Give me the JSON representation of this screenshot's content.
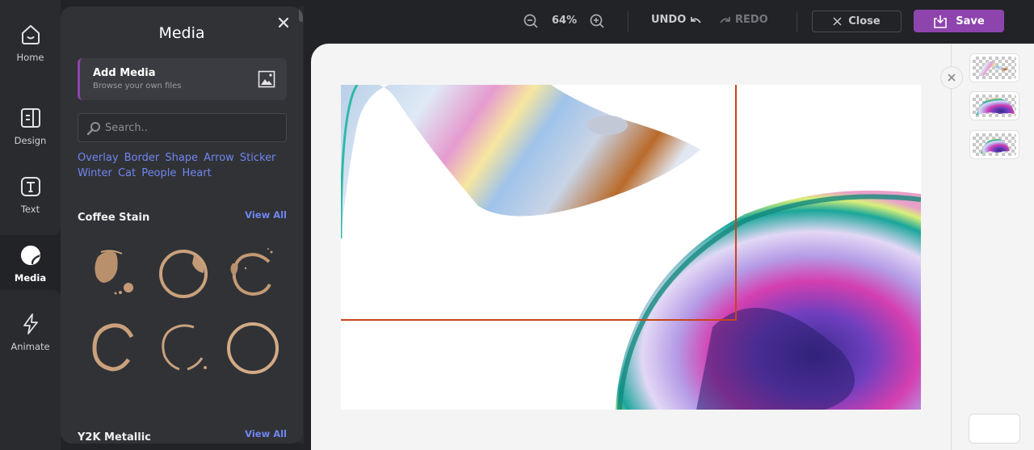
{
  "rail": {
    "items": [
      {
        "label": "Home",
        "icon": "home-icon"
      },
      {
        "label": "Design",
        "icon": "design-icon"
      },
      {
        "label": "Text",
        "icon": "text-icon"
      },
      {
        "label": "Media",
        "icon": "media-sticker-icon",
        "active": true
      },
      {
        "label": "Animate",
        "icon": "lightning-icon"
      }
    ]
  },
  "panel": {
    "title": "Media",
    "add_media": {
      "title": "Add Media",
      "subtitle": "Browse your own files"
    },
    "search": {
      "placeholder": "Search.."
    },
    "tags": [
      "Overlay",
      "Border",
      "Shape",
      "Arrow",
      "Sticker",
      "Winter",
      "Cat",
      "People",
      "Heart"
    ],
    "sections": [
      {
        "title": "Coffee Stain",
        "view_all": "View All",
        "item_count": 6
      },
      {
        "title": "Y2K Metallic",
        "view_all": "View All"
      }
    ]
  },
  "toolbar": {
    "zoom_value": "64%",
    "undo_label": "UNDO",
    "redo_label": "REDO",
    "close_label": "Close",
    "save_label": "Save"
  },
  "colors": {
    "accent": "#8e44ad",
    "link": "#6f86f0",
    "selection": "#c8451b",
    "dark_bg": "#212327",
    "panel_bg": "#313236"
  },
  "layers": [
    {
      "name": "metallic-wave-layer"
    },
    {
      "name": "bubble-arc-layer"
    },
    {
      "name": "bubble-arc-small-layer"
    }
  ]
}
